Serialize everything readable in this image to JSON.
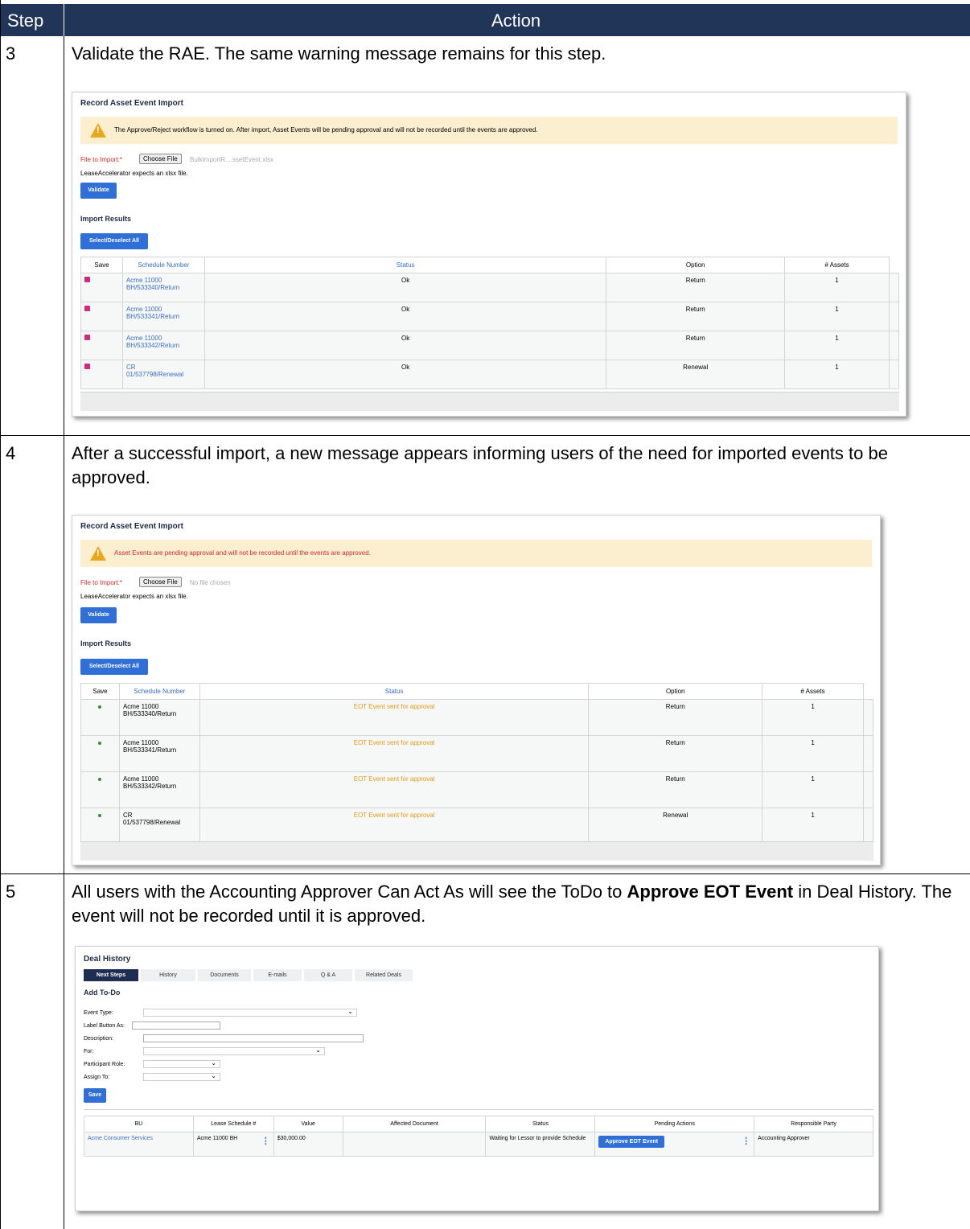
{
  "header": {
    "step": "Step",
    "action": "Action"
  },
  "steps": [
    {
      "num": "3",
      "desc": "Validate the RAE. The same warning message remains for this step."
    },
    {
      "num": "4",
      "desc": "After a successful import, a new message appears informing users of the need for imported events to be approved."
    },
    {
      "num": "5",
      "desc_pre": "All users with the Accounting Approver Can Act As will see the ToDo to ",
      "desc_bold": "Approve EOT Event",
      "desc_post": " in Deal History. The event will not be recorded until it is approved."
    }
  ],
  "shot1": {
    "title": "Record Asset Event Import",
    "warning": "The Approve/Reject workflow is turned on. After import, Asset Events will be pending approval and will not be recorded until the events are approved.",
    "file_label": "File to Import:*",
    "choose_file": "Choose File",
    "file_name": "BulkImportR....ssetEvent.xlsx",
    "expects": "LeaseAccelerator expects an xlsx file.",
    "validate": "Validate",
    "results": "Import Results",
    "select_all": "Select/Deselect All",
    "columns": [
      "Save",
      "Schedule Number",
      "Status",
      "Option",
      "# Assets"
    ],
    "rows": [
      {
        "sched1": "Acme 11000",
        "sched2": "BH/533340/Return",
        "status": "Ok",
        "option": "Return",
        "assets": "1"
      },
      {
        "sched1": "Acme 11000",
        "sched2": "BH/533341/Return",
        "status": "Ok",
        "option": "Return",
        "assets": "1"
      },
      {
        "sched1": "Acme 11000",
        "sched2": "BH/533342/Return",
        "status": "Ok",
        "option": "Return",
        "assets": "1"
      },
      {
        "sched1": "CR",
        "sched2": "01/537798/Renewal",
        "status": "Ok",
        "option": "Renewal",
        "assets": "1"
      }
    ]
  },
  "shot2": {
    "title": "Record Asset Event Import",
    "warning": "Asset Events are pending approval and will not be recorded until the events are approved.",
    "file_label": "File to Import:*",
    "choose_file": "Choose File",
    "file_name": "No file chosen",
    "expects": "LeaseAccelerator expects an xlsx file.",
    "validate": "Validate",
    "results": "Import Results",
    "select_all": "Select/Deselect All",
    "columns": [
      "Save",
      "Schedule Number",
      "Status",
      "Option",
      "# Assets"
    ],
    "rows": [
      {
        "sched1": "Acme 11000",
        "sched2": "BH/533340/Return",
        "status": "EOT Event sent for approval",
        "option": "Return",
        "assets": "1"
      },
      {
        "sched1": "Acme 11000",
        "sched2": "BH/533341/Return",
        "status": "EOT Event sent for approval",
        "option": "Return",
        "assets": "1"
      },
      {
        "sched1": "Acme 11000",
        "sched2": "BH/533342/Return",
        "status": "EOT Event sent for approval",
        "option": "Return",
        "assets": "1"
      },
      {
        "sched1": "CR",
        "sched2": "01/537798/Renewal",
        "status": "EOT Event sent for approval",
        "option": "Renewal",
        "assets": "1"
      }
    ]
  },
  "shot3": {
    "title": "Deal History",
    "tabs": [
      "Next Steps",
      "History",
      "Documents",
      "E-mails",
      "Q & A",
      "Related Deals"
    ],
    "add_todo": "Add To-Do",
    "fields": [
      "Event Type:",
      "Label Button As:",
      "Description:",
      "For:",
      "Participant Role:",
      "Assign To:"
    ],
    "save": "Save",
    "columns": [
      "BU",
      "Lease Schedule #",
      "Value",
      "Affected Document",
      "Status",
      "Pending Actions",
      "Responsible Party"
    ],
    "row": {
      "bu": "Acme Consumer Services",
      "schedule": "Acme 11000 BH",
      "value": "$30,000.00",
      "doc": "",
      "status": "Waiting for Lessor to provide Schedule",
      "action": "Approve EOT Event",
      "party": "Accounting Approver"
    }
  }
}
